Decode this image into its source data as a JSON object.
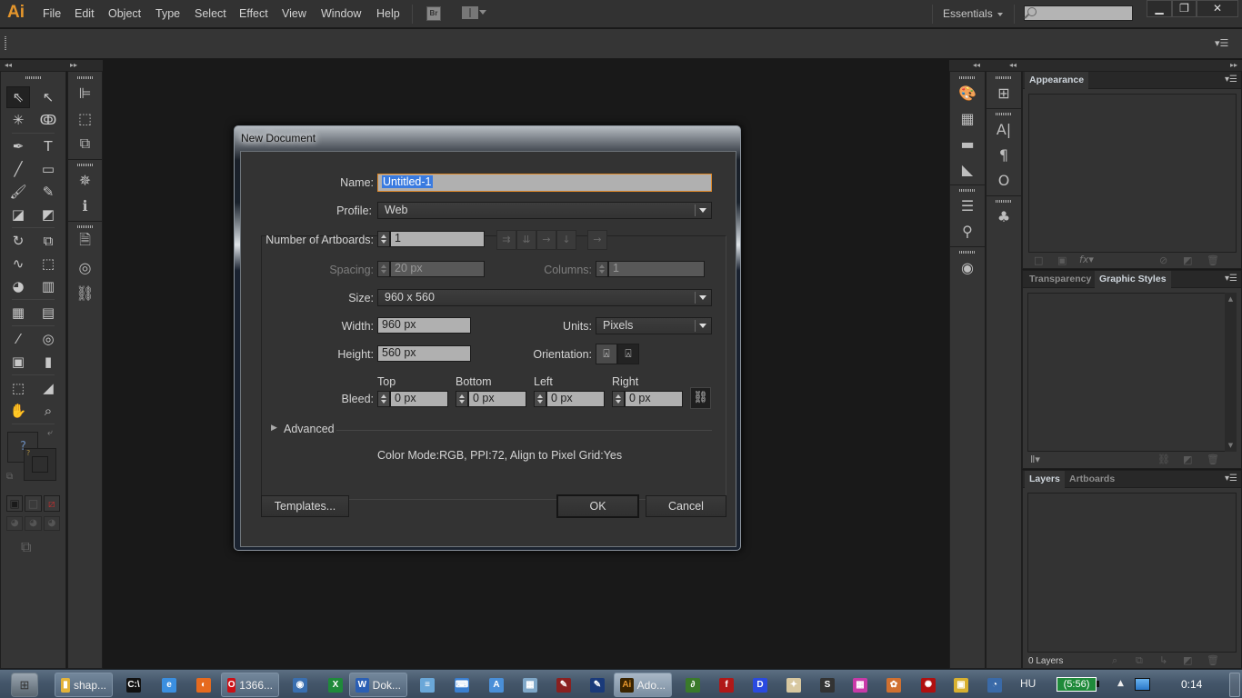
{
  "app": {
    "logo": "Ai",
    "menu": [
      "File",
      "Edit",
      "Object",
      "Type",
      "Select",
      "Effect",
      "View",
      "Window",
      "Help"
    ],
    "bridge_label": "Br",
    "workspace": "Essentials",
    "search_placeholder": "",
    "window_controls": {
      "minimize": "▁",
      "restore": "❐",
      "close": "✕"
    }
  },
  "dialog": {
    "title": "New Document",
    "name_label": "Name:",
    "name_value": "Untitled-1",
    "profile_label": "Profile:",
    "profile_value": "Web",
    "artboards_label": "Number of Artboards:",
    "artboards_value": "1",
    "artboard_layout_icons": [
      "grid-by-row-icon",
      "grid-by-column-icon",
      "arrange-by-row-icon",
      "arrange-by-column-icon",
      "right-to-left-icon"
    ],
    "spacing_label": "Spacing:",
    "spacing_value": "20 px",
    "columns_label": "Columns:",
    "columns_value": "1",
    "size_label": "Size:",
    "size_value": "960 x 560",
    "width_label": "Width:",
    "width_value": "960 px",
    "units_label": "Units:",
    "units_value": "Pixels",
    "height_label": "Height:",
    "height_value": "560 px",
    "orientation_label": "Orientation:",
    "orientation_selected": "portrait",
    "bleed_label": "Bleed:",
    "bleed": [
      {
        "label": "Top",
        "value": "0 px"
      },
      {
        "label": "Bottom",
        "value": "0 px"
      },
      {
        "label": "Left",
        "value": "0 px"
      },
      {
        "label": "Right",
        "value": "0 px"
      }
    ],
    "advanced_label": "Advanced",
    "summary": "Color Mode:RGB, PPI:72, Align to Pixel Grid:Yes",
    "templates_button": "Templates...",
    "ok_button": "OK",
    "cancel_button": "Cancel"
  },
  "tools": {
    "rows": [
      [
        "selection-tool",
        "direct-selection-tool"
      ],
      [
        "magic-wand-tool",
        "lasso-tool"
      ],
      [
        "pen-tool",
        "type-tool"
      ],
      [
        "line-segment-tool",
        "rectangle-tool"
      ],
      [
        "paintbrush-tool",
        "pencil-tool"
      ],
      [
        "blob-brush-tool",
        "eraser-tool"
      ],
      [
        "rotate-tool",
        "scale-tool"
      ],
      [
        "warp-tool",
        "free-transform-tool"
      ],
      [
        "shape-builder-tool",
        "perspective-grid-tool"
      ],
      [
        "mesh-tool",
        "gradient-tool"
      ],
      [
        "eyedropper-tool",
        "blend-tool"
      ],
      [
        "symbol-sprayer-tool",
        "column-graph-tool"
      ],
      [
        "artboard-tool",
        "slice-tool"
      ],
      [
        "hand-tool",
        "zoom-tool"
      ]
    ],
    "glyphs": [
      "⇖",
      "↖",
      "✳",
      "ↂ",
      "✒",
      "T",
      "╱",
      "▭",
      "🖌",
      "✎",
      "◪",
      "◩",
      "↻",
      "⧉",
      "∿",
      "⬚",
      "◕",
      "▥",
      "▦",
      "▤",
      "⁄",
      "◎",
      "▣",
      "▮",
      "⬚",
      "◢",
      "✋",
      "⌕"
    ],
    "fill_unknown": "?",
    "stroke_unknown": "?"
  },
  "left_dock": {
    "icons": [
      {
        "name": "align-icon",
        "glyph": "⊫"
      },
      {
        "name": "transform-icon",
        "glyph": "⬚"
      },
      {
        "name": "pathfinder-icon",
        "glyph": "⧉"
      },
      {
        "name": "symbols-icon",
        "glyph": "✵"
      },
      {
        "name": "info-icon",
        "glyph": "ℹ"
      },
      {
        "name": "document-info-icon",
        "glyph": "🗎"
      },
      {
        "name": "links-embed-icon",
        "glyph": "◎"
      },
      {
        "name": "links-icon",
        "glyph": "⛓"
      }
    ]
  },
  "right_dock": {
    "col1": [
      {
        "name": "color-icon",
        "glyph": "🎨"
      },
      {
        "name": "swatches-icon",
        "glyph": "▦"
      },
      {
        "name": "gradient-icon",
        "glyph": "▬"
      },
      {
        "name": "color-guide-icon",
        "glyph": "◣"
      },
      {
        "name": "stroke-icon",
        "glyph": "☰"
      },
      {
        "name": "brushes-icon",
        "glyph": "⚲"
      },
      {
        "name": "navigator-icon",
        "glyph": "◉"
      }
    ],
    "col2": [
      {
        "name": "transform-panel-icon",
        "glyph": "⊞"
      },
      {
        "name": "character-icon",
        "glyph": "A|"
      },
      {
        "name": "paragraph-icon",
        "glyph": "¶"
      },
      {
        "name": "opentype-icon",
        "glyph": "O"
      },
      {
        "name": "symbols-club-icon",
        "glyph": "♣"
      }
    ]
  },
  "panels": {
    "appearance": {
      "tabs": [
        "Appearance"
      ],
      "active": 0
    },
    "styles": {
      "tabs": [
        "Transparency",
        "Graphic Styles"
      ],
      "active": 1
    },
    "layers": {
      "tabs": [
        "Layers",
        "Artboards"
      ],
      "active": 0,
      "status": "0 Layers"
    }
  },
  "taskbar": {
    "items": [
      {
        "name": "explorer",
        "label": "shap...",
        "color": "#e3b33a",
        "glyph": "▮"
      },
      {
        "name": "cmd",
        "label": "",
        "color": "#111",
        "glyph": "C:\\"
      },
      {
        "name": "internet-explorer",
        "label": "",
        "color": "#3b8fe0",
        "glyph": "e"
      },
      {
        "name": "firefox",
        "label": "",
        "color": "#e66a1e",
        "glyph": "◐"
      },
      {
        "name": "opera",
        "label": "1366...",
        "color": "#cc0f16",
        "glyph": "O"
      },
      {
        "name": "thunderbird",
        "label": "",
        "color": "#3a6fb0",
        "glyph": "◉"
      },
      {
        "name": "excel",
        "label": "",
        "color": "#1f8a3a",
        "glyph": "X"
      },
      {
        "name": "word",
        "label": "Dok...",
        "color": "#2b5fb4",
        "glyph": "W"
      },
      {
        "name": "notepad",
        "label": "",
        "color": "#6aa7d8",
        "glyph": "≡"
      },
      {
        "name": "keyboard",
        "label": "",
        "color": "#3b7fd0",
        "glyph": "⌨"
      },
      {
        "name": "wordpad",
        "label": "",
        "color": "#4a8fd8",
        "glyph": "A"
      },
      {
        "name": "calculator",
        "label": "",
        "color": "#7fa7c8",
        "glyph": "▦"
      },
      {
        "name": "app-red",
        "label": "",
        "color": "#8a2020",
        "glyph": "✎"
      },
      {
        "name": "app-blue",
        "label": "",
        "color": "#1a3a7a",
        "glyph": "✎"
      },
      {
        "name": "illustrator",
        "label": "Ado...",
        "color": "#3a2400",
        "glyph": "Ai"
      },
      {
        "name": "dreamweaver-green",
        "label": "",
        "color": "#3a7a2a",
        "glyph": "∂"
      },
      {
        "name": "flash",
        "label": "",
        "color": "#b01818",
        "glyph": "f"
      },
      {
        "name": "app-d",
        "label": "",
        "color": "#2a4ae0",
        "glyph": "D"
      },
      {
        "name": "paint",
        "label": "",
        "color": "#d8c8a0",
        "glyph": "✦"
      },
      {
        "name": "app-s",
        "label": "",
        "color": "#333",
        "glyph": "S"
      },
      {
        "name": "app-mosaic",
        "label": "",
        "color": "#c83aa8",
        "glyph": "▦"
      },
      {
        "name": "app-pinwheel",
        "label": "",
        "color": "#d07030",
        "glyph": "✿"
      },
      {
        "name": "app-red-bug",
        "label": "",
        "color": "#b01010",
        "glyph": "✺"
      },
      {
        "name": "app-yellow",
        "label": "",
        "color": "#d8b030",
        "glyph": "▣"
      },
      {
        "name": "app-globe",
        "label": "",
        "color": "#3a6aa8",
        "glyph": "◔"
      }
    ],
    "language": "HU",
    "battery": "(5:56)",
    "clock": "0:14"
  }
}
